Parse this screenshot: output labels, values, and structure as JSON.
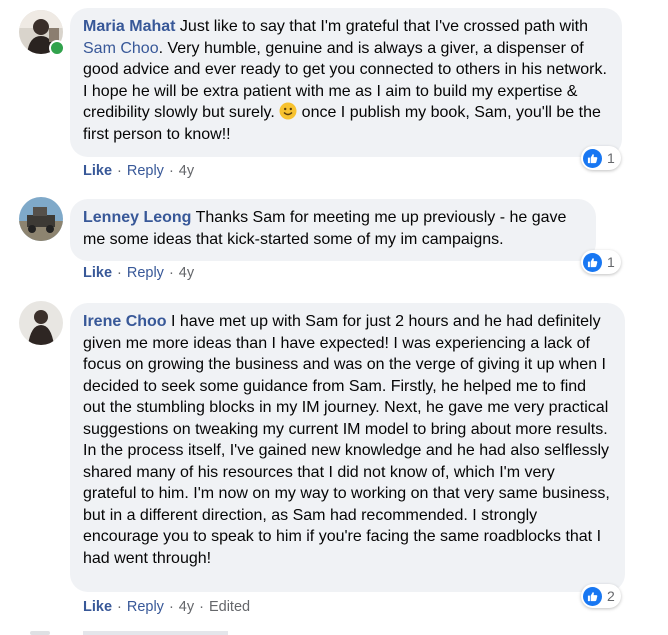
{
  "comments": [
    {
      "author": "Maria Mahat",
      "text_before": "Just like to say that I'm grateful that I've crossed path with ",
      "mention": "Sam Choo",
      "text_middle": ". Very humble, genuine and is always a giver, a dispenser of good advice and ever ready to get you connected to others in his network. I hope he will be extra patient with me as I aim to build my expertise & credibility slowly but surely. ",
      "emoji": "smiley-emoji",
      "text_after": " once I publish my book, Sam, you'll be the first person to know!!",
      "like_label": "Like",
      "reply_label": "Reply",
      "time": "4y",
      "reaction_count": "1",
      "online": true
    },
    {
      "author": "Lenney Leong",
      "text": "Thanks Sam for meeting me up previously - he gave me some ideas that kick-started some of my im campaigns.",
      "like_label": "Like",
      "reply_label": "Reply",
      "time": "4y",
      "reaction_count": "1"
    },
    {
      "author": "Irene Choo",
      "text": "I have met up with Sam for just 2 hours and he had definitely given me more ideas than I have expected! I was experiencing a lack of focus on growing the business and was on the verge of giving it up when I decided to seek some guidance from Sam. Firstly, he helped me to find out the stumbling blocks in my IM journey. Next, he gave me very practical suggestions on tweaking my current IM model to bring about more results. In the process itself, I've gained new knowledge and he had also selflessly shared many of his resources that I did not know of, which I'm very grateful to him. I'm now on my way to working on that very same business, but in a different direction, as Sam had recommended. I strongly encourage you to speak to him if you're facing the same roadblocks that I had went through!",
      "like_label": "Like",
      "reply_label": "Reply",
      "time": "4y",
      "edited_label": "Edited",
      "reaction_count": "2"
    }
  ],
  "separator": "·",
  "colors": {
    "link": "#385898",
    "bubble": "#f0f2f5",
    "meta": "#65676b",
    "like_badge": "#1877f2",
    "online": "#31a24c"
  }
}
